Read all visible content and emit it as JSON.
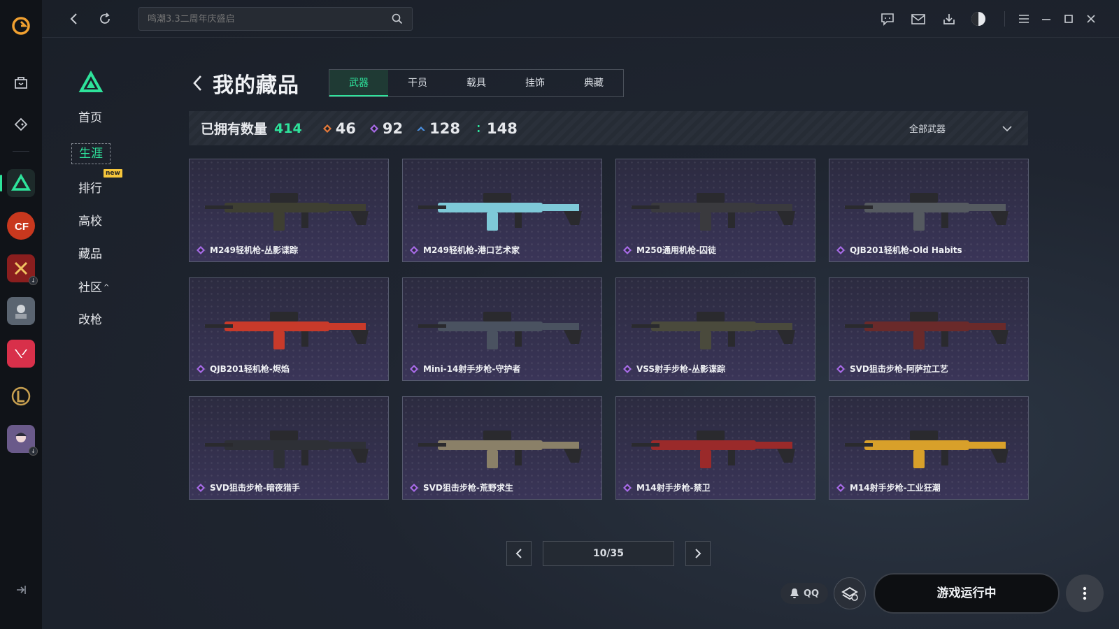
{
  "search": {
    "placeholder": "鸣潮3.3二周年庆盛启"
  },
  "sidenav": {
    "items": [
      {
        "label": "首页"
      },
      {
        "label": "生涯"
      },
      {
        "label": "排行",
        "badge": "new"
      },
      {
        "label": "高校"
      },
      {
        "label": "藏品"
      },
      {
        "label": "社区",
        "caret": "^"
      },
      {
        "label": "改枪"
      }
    ]
  },
  "header": {
    "title": "我的藏品",
    "tabs": [
      {
        "label": "武器"
      },
      {
        "label": "干员"
      },
      {
        "label": "载具"
      },
      {
        "label": "挂饰"
      },
      {
        "label": "典藏"
      }
    ]
  },
  "stats": {
    "owned_label": "已拥有数量",
    "owned_count": "414",
    "rarities": [
      {
        "value": "46",
        "color": "#e87a3a"
      },
      {
        "value": "92",
        "color": "#a86be8"
      },
      {
        "value": "128",
        "color": "#4a8fe0"
      },
      {
        "value": "148",
        "color": "#2ee39b"
      }
    ],
    "filter_label": "全部武器"
  },
  "items": [
    {
      "name": "M249轻机枪-丛影谍踪",
      "gun_color": "#3e3f32"
    },
    {
      "name": "M249轻机枪-港口艺术家",
      "gun_color": "#7ec9d8"
    },
    {
      "name": "M250通用机枪-囚徒",
      "gun_color": "#3a3a3e"
    },
    {
      "name": "QJB201轻机枪-Old Habits",
      "gun_color": "#555a60"
    },
    {
      "name": "QJB201轻机枪-烬焰",
      "gun_color": "#c83a2a"
    },
    {
      "name": "Mini-14射手步枪-守护者",
      "gun_color": "#4a5260"
    },
    {
      "name": "VSS射手步枪-丛影谍踪",
      "gun_color": "#4a4a3c"
    },
    {
      "name": "SVD狙击步枪-阿萨拉工艺",
      "gun_color": "#6a2a2a"
    },
    {
      "name": "SVD狙击步枪-暗夜猎手",
      "gun_color": "#2e3036"
    },
    {
      "name": "SVD狙击步枪-荒野求生",
      "gun_color": "#8a8068"
    },
    {
      "name": "M14射手步枪-禁卫",
      "gun_color": "#9a2a2a"
    },
    {
      "name": "M14射手步枪-工业狂潮",
      "gun_color": "#d8a02a"
    }
  ],
  "pager": {
    "current": "10/35"
  },
  "bottom": {
    "qq_label": "QQ",
    "play_label": "游戏运行中"
  },
  "colors": {
    "accent": "#2ee39b",
    "item_rarity": "#a86be8"
  }
}
